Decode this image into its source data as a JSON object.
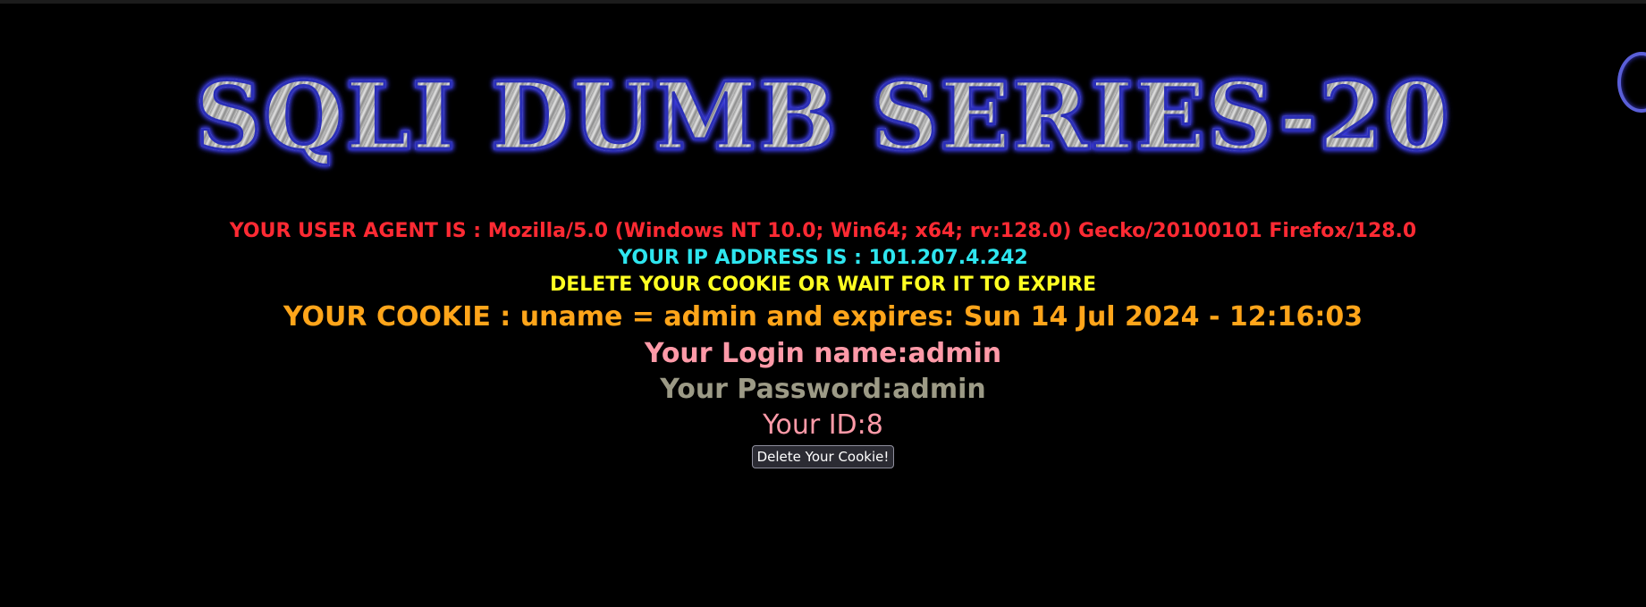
{
  "banner": {
    "title": "SQLI DUMB SERIES-20"
  },
  "info": {
    "user_agent": "YOUR USER AGENT IS : Mozilla/5.0 (Windows NT 10.0; Win64; x64; rv:128.0) Gecko/20100101 Firefox/128.0",
    "ip_address": "YOUR IP ADDRESS IS : 101.207.4.242",
    "delete_notice": "DELETE YOUR COOKIE OR WAIT FOR IT TO EXPIRE",
    "cookie": "YOUR COOKIE : uname = admin and expires: Sun 14 Jul 2024 - 12:16:03",
    "login_name": "Your Login name:admin",
    "password": "Your Password:admin",
    "id": "Your ID:8"
  },
  "actions": {
    "delete_cookie_label": "Delete Your Cookie!"
  },
  "colors": {
    "background": "#000000",
    "user_agent": "#ff2a33",
    "ip_address": "#2ee6ef",
    "delete_notice": "#ffff22",
    "cookie": "#ffa51a",
    "login_name": "#ff9aa8",
    "password": "#9c9a86",
    "id": "#ff9aa8",
    "banner_outline": "#2b2fb8"
  },
  "icons": {
    "corner_logo": "partial-circle-logo-icon"
  }
}
